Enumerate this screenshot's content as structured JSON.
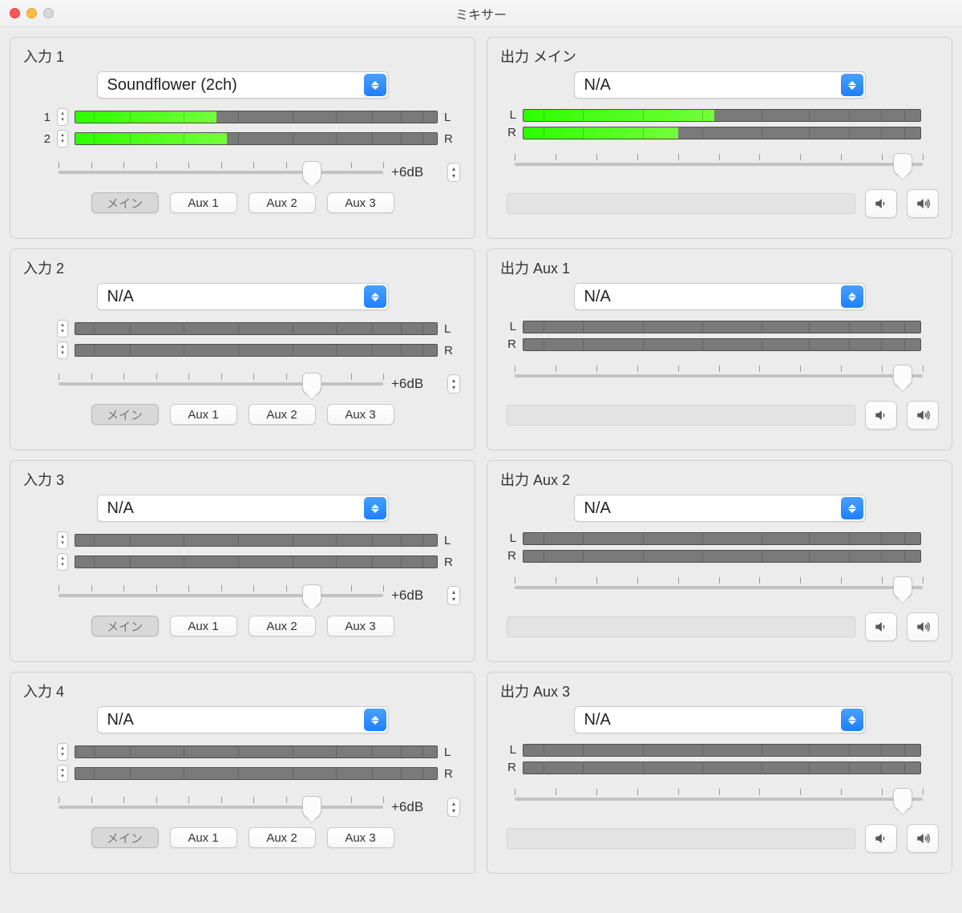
{
  "window": {
    "title": "ミキサー"
  },
  "labels": {
    "L": "L",
    "R": "R"
  },
  "inputs": [
    {
      "title": "入力 1",
      "device": "Soundflower (2ch)",
      "channels": [
        {
          "num": "1",
          "level": 0.39
        },
        {
          "num": "2",
          "level": 0.42
        }
      ],
      "gain": "+6dB",
      "gain_pos": 0.78,
      "routes": [
        "メイン",
        "Aux 1",
        "Aux 2",
        "Aux 3"
      ],
      "route_active": 0
    },
    {
      "title": "入力 2",
      "device": "N/A",
      "channels": [
        {
          "num": "",
          "level": 0
        },
        {
          "num": "",
          "level": 0
        }
      ],
      "gain": "+6dB",
      "gain_pos": 0.78,
      "routes": [
        "メイン",
        "Aux 1",
        "Aux 2",
        "Aux 3"
      ],
      "route_active": 0
    },
    {
      "title": "入力 3",
      "device": "N/A",
      "channels": [
        {
          "num": "",
          "level": 0
        },
        {
          "num": "",
          "level": 0
        }
      ],
      "gain": "+6dB",
      "gain_pos": 0.78,
      "routes": [
        "メイン",
        "Aux 1",
        "Aux 2",
        "Aux 3"
      ],
      "route_active": 0
    },
    {
      "title": "入力 4",
      "device": "N/A",
      "channels": [
        {
          "num": "",
          "level": 0
        },
        {
          "num": "",
          "level": 0
        }
      ],
      "gain": "+6dB",
      "gain_pos": 0.78,
      "routes": [
        "メイン",
        "Aux 1",
        "Aux 2",
        "Aux 3"
      ],
      "route_active": 0
    }
  ],
  "outputs": [
    {
      "title": "出力 メイン",
      "device": "N/A",
      "channels": [
        {
          "lab": "L",
          "level": 0.48
        },
        {
          "lab": "R",
          "level": 0.39
        }
      ],
      "vol_pos": 0.95
    },
    {
      "title": "出力 Aux 1",
      "device": "N/A",
      "channels": [
        {
          "lab": "L",
          "level": 0
        },
        {
          "lab": "R",
          "level": 0
        }
      ],
      "vol_pos": 0.95
    },
    {
      "title": "出力 Aux 2",
      "device": "N/A",
      "channels": [
        {
          "lab": "L",
          "level": 0
        },
        {
          "lab": "R",
          "level": 0
        }
      ],
      "vol_pos": 0.95
    },
    {
      "title": "出力 Aux 3",
      "device": "N/A",
      "channels": [
        {
          "lab": "L",
          "level": 0
        },
        {
          "lab": "R",
          "level": 0
        }
      ],
      "vol_pos": 0.95
    }
  ],
  "icons": {
    "speaker_low": "speaker-low-icon",
    "speaker_high": "speaker-high-icon"
  }
}
